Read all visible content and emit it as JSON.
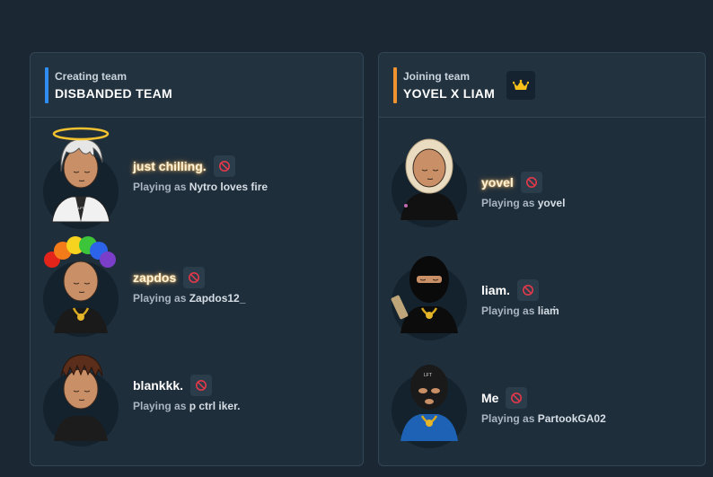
{
  "teams": [
    {
      "subtitle": "Creating team",
      "title": "DISBANDED TEAM",
      "accent_color": "#2f8cf0",
      "crown": false,
      "members": [
        {
          "name": "just chilling.",
          "playing_prefix": "Playing as",
          "playing_as": "Nytro loves fire",
          "glow": true
        },
        {
          "name": "zapdos",
          "playing_prefix": "Playing as",
          "playing_as": "Zapdos12_",
          "glow": true
        },
        {
          "name": "blankkk.",
          "playing_prefix": "Playing as",
          "playing_as": "p ctrl iker.",
          "glow": false
        }
      ]
    },
    {
      "subtitle": "Joining team",
      "title": "YOVEL X LIAM",
      "accent_color": "#f0922f",
      "crown": true,
      "crown_icon": "crown-icon",
      "members": [
        {
          "name": "yovel",
          "playing_prefix": "Playing as",
          "playing_as": "yovel",
          "glow": true
        },
        {
          "name": "liam.",
          "playing_prefix": "Playing as",
          "playing_as": "liaṁ",
          "glow": false
        },
        {
          "name": "Me",
          "playing_prefix": "Playing as",
          "playing_as": "PartookGA02",
          "glow": false
        }
      ]
    }
  ],
  "icons": {
    "ban": "ban-icon",
    "crown": "crown-icon"
  },
  "colors": {
    "background": "#1b2733",
    "panel": "#1f2e3b",
    "crown": "#f6c21a",
    "ban": "#e0394a"
  }
}
